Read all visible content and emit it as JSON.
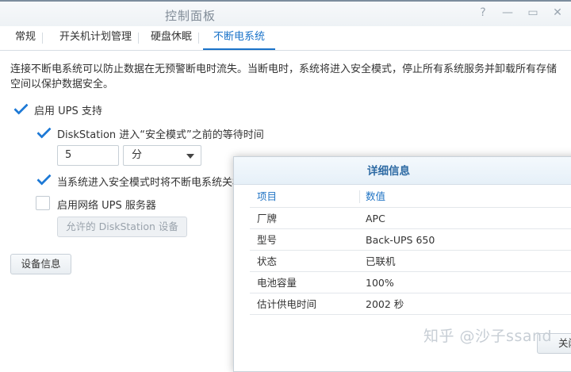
{
  "window": {
    "title": "控制面板",
    "help_icon": "?",
    "minimize_icon": "—",
    "maximize_icon": "▭",
    "close_icon": "✕"
  },
  "tabs": [
    {
      "label": "常规"
    },
    {
      "label": "开关机计划管理"
    },
    {
      "label": "硬盘休眠"
    },
    {
      "label": "不断电系统",
      "active": true
    }
  ],
  "description": "连接不断电系统可以防止数据在无预警断电时流失。当断电时，系统将进入安全模式，停止所有系统服务并卸载所有存储空间以保护数据安全。",
  "options": {
    "enable_ups": {
      "label": "启用 UPS 支持",
      "checked": true
    },
    "wait_time": {
      "label": "DiskStation 进入“安全模式”之前的等待时间",
      "checked": true
    },
    "wait_value": "5",
    "wait_unit": "分",
    "shutdown_ups": {
      "label": "当系统进入安全模式时将不断电系统关机",
      "checked": true
    },
    "network_ups": {
      "label": "启用网络 UPS 服务器",
      "checked": false
    },
    "allowed_button": "允许的 DiskStation 设备",
    "device_info_button": "设备信息"
  },
  "details": {
    "title": "详细信息",
    "headers": {
      "item": "项目",
      "value": "数值"
    },
    "rows": [
      {
        "item": "厂牌",
        "value": "APC"
      },
      {
        "item": "型号",
        "value": "Back-UPS 650"
      },
      {
        "item": "状态",
        "value": "已联机"
      },
      {
        "item": "电池容量",
        "value": "100%"
      },
      {
        "item": "估计供电时间",
        "value": "2002 秒"
      }
    ],
    "close_button": "关闭"
  },
  "watermark": "知乎 @沙子ssand",
  "colors": {
    "accent": "#1a73c9",
    "checkbox": "#1f7ad6",
    "dialog_title": "#2d6aa3"
  }
}
